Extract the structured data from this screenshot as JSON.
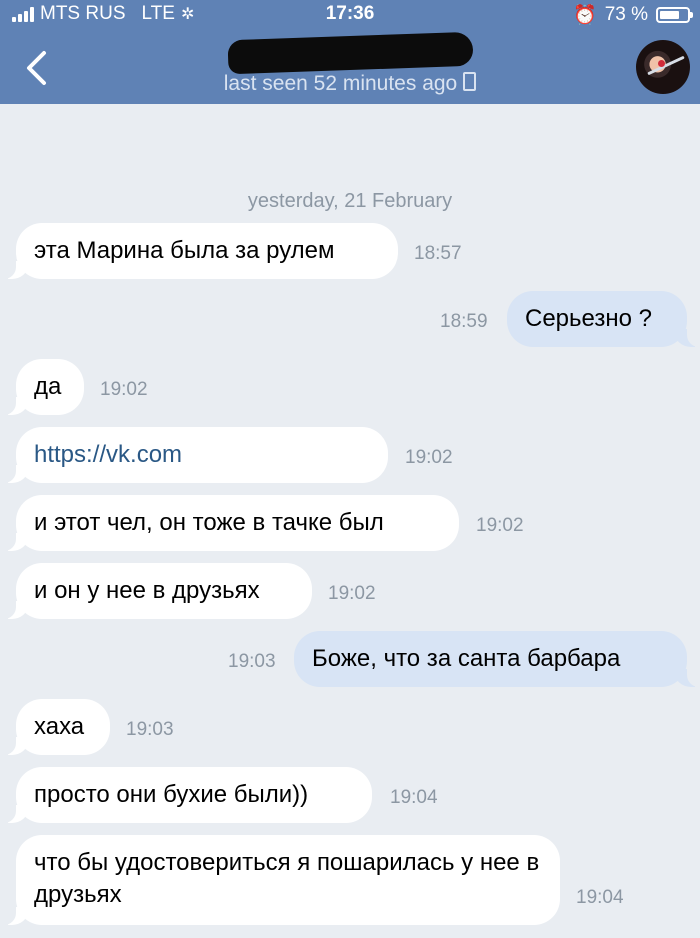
{
  "status_bar": {
    "carrier": "MTS RUS",
    "network": "LTE",
    "time": "17:36",
    "battery": "73 %",
    "battery_level": 0.73
  },
  "header": {
    "back_icon": "chevron-left-icon",
    "last_seen": "last seen 52 minutes ago"
  },
  "chat": {
    "date_separator": "yesterday, 21 February",
    "messages": [
      {
        "dir": "in",
        "text": "эта Марина была за рулем",
        "time": "18:57"
      },
      {
        "dir": "out",
        "text": "Серьезно ?",
        "time": "18:59"
      },
      {
        "dir": "in",
        "text": "да",
        "time": "19:02"
      },
      {
        "dir": "in",
        "text": "https://vk.com",
        "time": "19:02"
      },
      {
        "dir": "in",
        "text": "и этот чел, он тоже в тачке был",
        "time": "19:02"
      },
      {
        "dir": "in",
        "text": "и он у нее в друзьях",
        "time": "19:02"
      },
      {
        "dir": "out",
        "text": "Боже, что за санта барбара",
        "time": "19:03"
      },
      {
        "dir": "in",
        "text": "хаха",
        "time": "19:03"
      },
      {
        "dir": "in",
        "text": "просто они бухие были))",
        "time": "19:04"
      },
      {
        "dir": "in",
        "text": "что бы удостовериться я пошарилась у нее в друзьях",
        "time": "19:04"
      }
    ]
  },
  "colors": {
    "header_bg": "#5f82b5",
    "chat_bg": "#e9edf2",
    "incoming_bubble": "#ffffff",
    "outgoing_bubble": "#d8e4f5",
    "link": "#2a5885"
  }
}
